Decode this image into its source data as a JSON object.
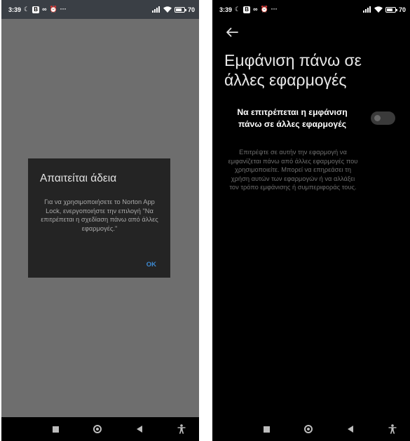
{
  "status_bar": {
    "time": "3:39",
    "battery_text": "70",
    "battery_level_percent": 70,
    "badge_letter": "B",
    "icons": [
      "moon-icon",
      "b-badge-icon",
      "infinity-icon",
      "alarm-icon",
      "more-icon",
      "signal-icon",
      "wifi-icon",
      "battery-icon"
    ],
    "moon_glyph": "☾",
    "infinity_glyph": "∞",
    "alarm_glyph": "⏰",
    "more_glyph": "···"
  },
  "left_screen": {
    "dialog": {
      "title": "Απαιτείται άδεια",
      "message": "Για να χρησιμοποιήσετε το Norton App Lock, ενεργοποιήστε την επιλογή \"Να επιτρέπεται η σχεδίαση πάνω από άλλες εφαρμογές.\"",
      "ok_label": "OK"
    }
  },
  "right_screen": {
    "title": "Εμφάνιση πάνω σε άλλες εφαρμογές",
    "setting": {
      "label": "Να επιτρέπεται η εμφάνιση πάνω σε άλλες εφαρμογές",
      "enabled": false
    },
    "description": "Επιτρέψτε σε αυτήν την εφαρμογή να εμφανίζεται πάνω από άλλες εφαρμογές που χρησιμοποιείτε. Μπορεί να επηρεάσει τη χρήση αυτών των εφαρμογών ή να αλλάξει τον τρόπο εμφάνισης ή συμπεριφοράς τους."
  },
  "nav_bar": {
    "buttons": [
      "recents-button",
      "home-button",
      "back-button",
      "accessibility-button"
    ]
  },
  "colors": {
    "dialog_background": "#242424",
    "accent": "#3d8bd4",
    "left_scrim": "#6e6e6e",
    "right_background": "#000000"
  }
}
